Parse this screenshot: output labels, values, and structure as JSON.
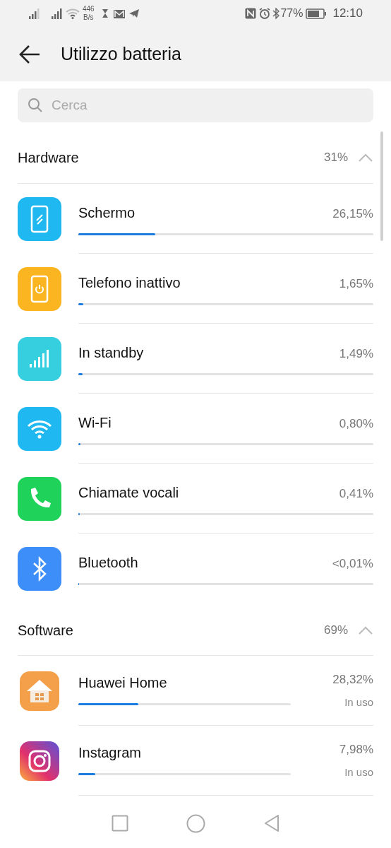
{
  "status_bar": {
    "speed_value": "446",
    "speed_unit": "B/s",
    "battery": "77%",
    "time": "12:10"
  },
  "header": {
    "title": "Utilizzo batteria"
  },
  "search": {
    "placeholder": "Cerca"
  },
  "sections": [
    {
      "title": "Hardware",
      "total": "31%",
      "expanded": true,
      "items": [
        {
          "kind": "screen",
          "name": "Schermo",
          "value": "26,15%",
          "level": 0.2615
        },
        {
          "kind": "idle",
          "name": "Telefono inattivo",
          "value": "1,65%",
          "level": 0.0165
        },
        {
          "kind": "signal",
          "name": "In standby",
          "value": "1,49%",
          "level": 0.0149
        },
        {
          "kind": "wifi",
          "name": "Wi-Fi",
          "value": "0,80%",
          "level": 0.008
        },
        {
          "kind": "phone",
          "name": "Chiamate vocali",
          "value": "0,41%",
          "level": 0.0041
        },
        {
          "kind": "bluetooth",
          "name": "Bluetooth",
          "value": "<0,01%",
          "level": 0.0
        }
      ]
    },
    {
      "title": "Software",
      "total": "69%",
      "expanded": true,
      "items": [
        {
          "kind": "home",
          "name": "Huawei Home",
          "value": "28,32%",
          "status": "In uso",
          "level": 0.2832
        },
        {
          "kind": "camera",
          "name": "Instagram",
          "value": "7,98%",
          "status": "In uso",
          "level": 0.0798
        }
      ]
    }
  ]
}
